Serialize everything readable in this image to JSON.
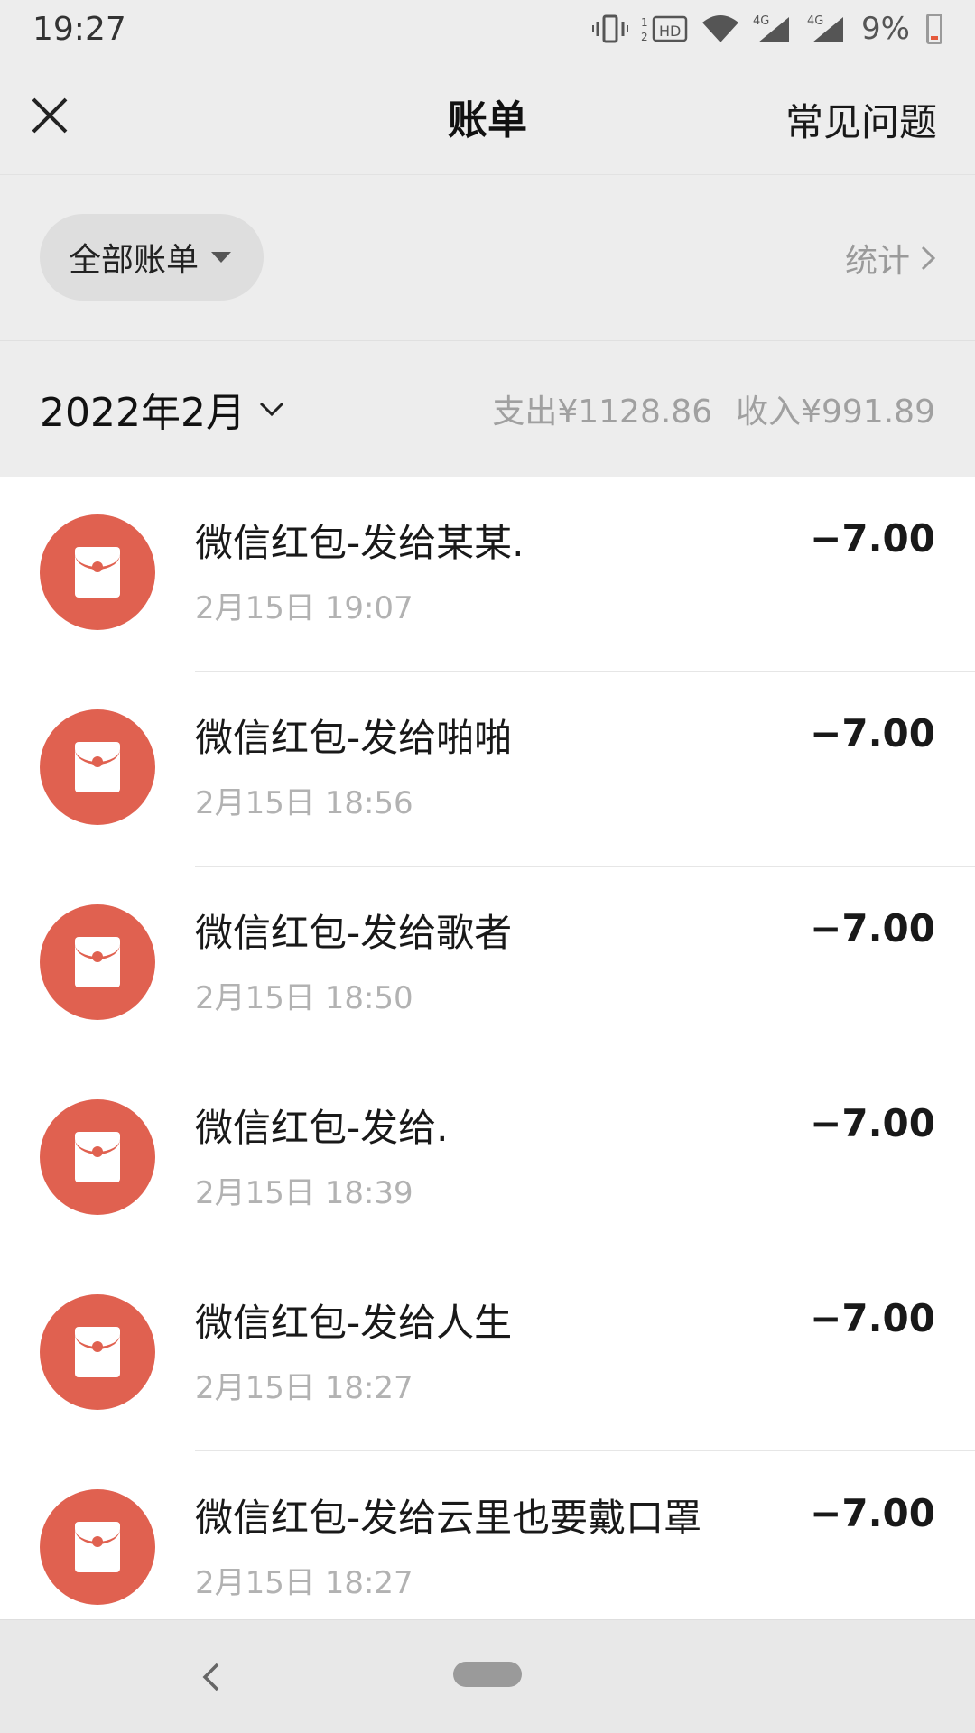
{
  "status_bar": {
    "time": "19:27",
    "battery": "9%",
    "network_1": "4G",
    "network_2": "4G",
    "hd": "HD"
  },
  "header": {
    "title": "账单",
    "faq_label": "常见问题",
    "close_icon": "close-icon"
  },
  "filter": {
    "selected": "全部账单",
    "stats_label": "统计"
  },
  "month": {
    "label": "2022年2月",
    "expense": "支出¥1128.86",
    "income": "收入¥991.89"
  },
  "transactions": [
    {
      "title": "微信红包-发给某某.",
      "time": "2月15日 19:07",
      "amount": "−7.00"
    },
    {
      "title": "微信红包-发给啪啪",
      "time": "2月15日 18:56",
      "amount": "−7.00"
    },
    {
      "title": "微信红包-发给歌者",
      "time": "2月15日 18:50",
      "amount": "−7.00"
    },
    {
      "title": "微信红包-发给.",
      "time": "2月15日 18:39",
      "amount": "−7.00"
    },
    {
      "title": "微信红包-发给人生",
      "time": "2月15日 18:27",
      "amount": "−7.00"
    },
    {
      "title": "微信红包-发给云里也要戴口罩",
      "time": "2月15日 18:27",
      "amount": "−7.00"
    }
  ],
  "colors": {
    "accent_red": "#e06150",
    "background": "#ededed"
  }
}
